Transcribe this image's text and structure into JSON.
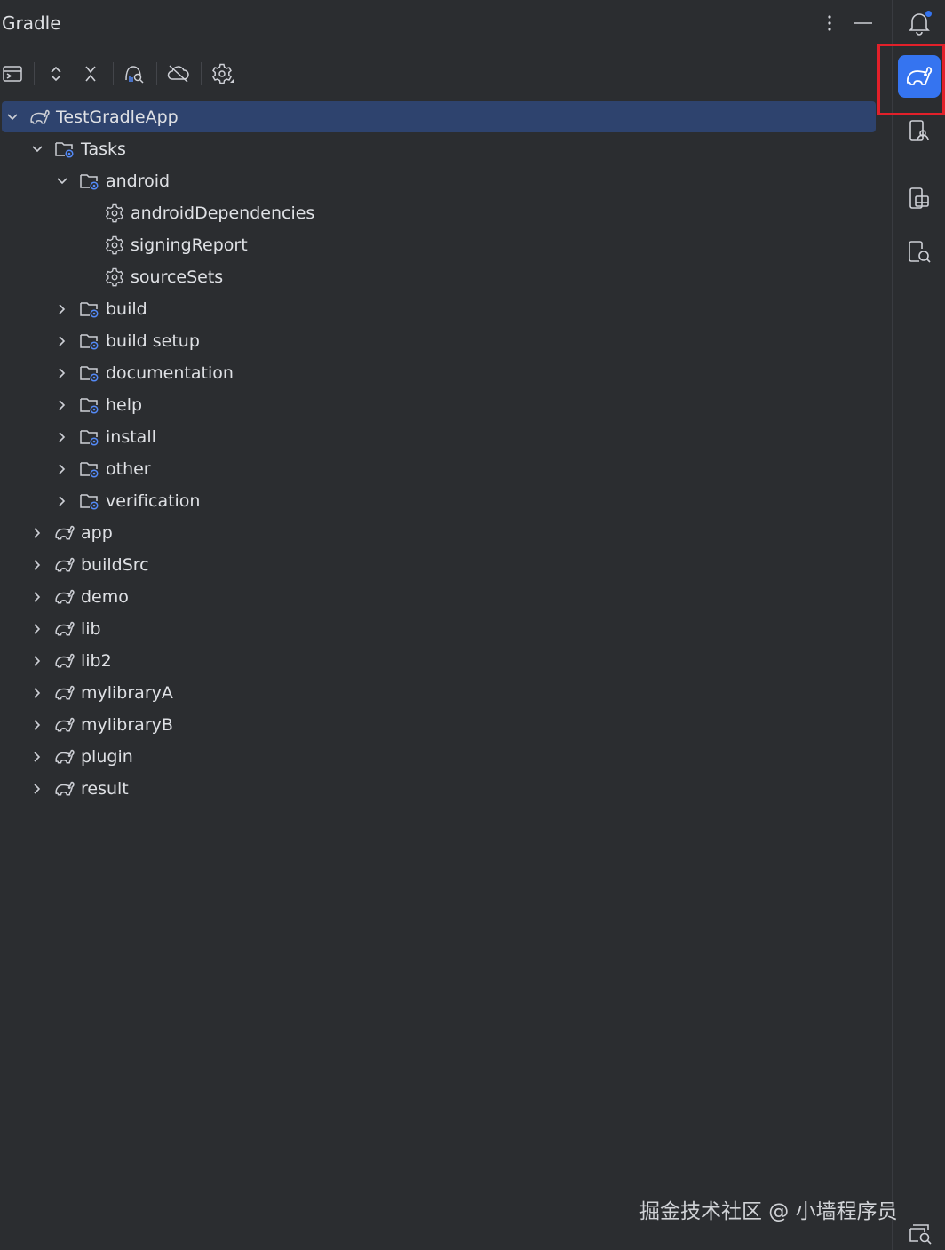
{
  "panel": {
    "title": "Gradle"
  },
  "header_actions": [
    {
      "name": "more-options",
      "icon": "vertical-dots-icon"
    },
    {
      "name": "minimize",
      "icon": "minus-icon"
    }
  ],
  "toolbar": [
    {
      "name": "execute-task",
      "icon": "run-window-icon"
    },
    {
      "name": "expand-all",
      "icon": "expand-all-icon"
    },
    {
      "name": "collapse-all",
      "icon": "collapse-all-icon"
    },
    {
      "name": "analyze-dependencies",
      "icon": "dependency-analyzer-icon"
    },
    {
      "name": "toggle-offline",
      "icon": "offline-cloud-icon"
    },
    {
      "name": "build-tool-settings",
      "icon": "gear-icon"
    }
  ],
  "tree": [
    {
      "label": "TestGradleApp",
      "depth": 0,
      "icon": "gradle-elephant-icon",
      "state": "expanded",
      "selected": true
    },
    {
      "label": "Tasks",
      "depth": 1,
      "icon": "task-folder-icon",
      "state": "expanded"
    },
    {
      "label": "android",
      "depth": 2,
      "icon": "task-folder-icon",
      "state": "expanded"
    },
    {
      "label": "androidDependencies",
      "depth": 3,
      "icon": "gear-icon",
      "state": "leaf"
    },
    {
      "label": "signingReport",
      "depth": 3,
      "icon": "gear-icon",
      "state": "leaf"
    },
    {
      "label": "sourceSets",
      "depth": 3,
      "icon": "gear-icon",
      "state": "leaf"
    },
    {
      "label": "build",
      "depth": 2,
      "icon": "task-folder-icon",
      "state": "collapsed"
    },
    {
      "label": "build setup",
      "depth": 2,
      "icon": "task-folder-icon",
      "state": "collapsed"
    },
    {
      "label": "documentation",
      "depth": 2,
      "icon": "task-folder-icon",
      "state": "collapsed"
    },
    {
      "label": "help",
      "depth": 2,
      "icon": "task-folder-icon",
      "state": "collapsed"
    },
    {
      "label": "install",
      "depth": 2,
      "icon": "task-folder-icon",
      "state": "collapsed"
    },
    {
      "label": "other",
      "depth": 2,
      "icon": "task-folder-icon",
      "state": "collapsed"
    },
    {
      "label": "verification",
      "depth": 2,
      "icon": "task-folder-icon",
      "state": "collapsed"
    },
    {
      "label": "app",
      "depth": 1,
      "icon": "gradle-elephant-icon",
      "state": "collapsed"
    },
    {
      "label": "buildSrc",
      "depth": 1,
      "icon": "gradle-elephant-icon",
      "state": "collapsed"
    },
    {
      "label": "demo",
      "depth": 1,
      "icon": "gradle-elephant-icon",
      "state": "collapsed"
    },
    {
      "label": "lib",
      "depth": 1,
      "icon": "gradle-elephant-icon",
      "state": "collapsed"
    },
    {
      "label": "lib2",
      "depth": 1,
      "icon": "gradle-elephant-icon",
      "state": "collapsed"
    },
    {
      "label": "mylibraryA",
      "depth": 1,
      "icon": "gradle-elephant-icon",
      "state": "collapsed"
    },
    {
      "label": "mylibraryB",
      "depth": 1,
      "icon": "gradle-elephant-icon",
      "state": "collapsed"
    },
    {
      "label": "plugin",
      "depth": 1,
      "icon": "gradle-elephant-icon",
      "state": "collapsed"
    },
    {
      "label": "result",
      "depth": 1,
      "icon": "gradle-elephant-icon",
      "state": "collapsed"
    }
  ],
  "right_sidebar": [
    {
      "name": "notifications",
      "icon": "bell-icon",
      "has_badge": true
    },
    {
      "name": "gradle",
      "icon": "gradle-elephant-icon",
      "active": true,
      "highlighted": true
    },
    {
      "name": "device-manager",
      "icon": "device-manager-icon"
    },
    {
      "name": "running-devices",
      "icon": "running-devices-icon"
    },
    {
      "name": "device-explorer",
      "icon": "device-explorer-icon"
    }
  ],
  "watermark": "掘金技术社区 @ 小墙程序员",
  "colors": {
    "background": "#2b2d30",
    "text": "#dfe1e5",
    "icon": "#ced0d6",
    "selection": "#2e436e",
    "accent": "#3574f0",
    "highlight_border": "#e2202a",
    "task_gear": "#548af7"
  }
}
